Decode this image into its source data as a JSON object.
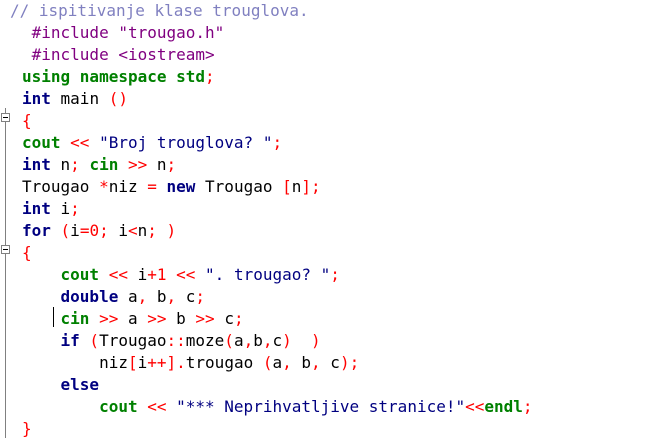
{
  "editor": {
    "lines": [
      [
        {
          "t": "// ispitivanje klase trouglova.",
          "c": "comment"
        }
      ],
      [
        {
          "t": " #include \"trougao.h\"",
          "c": "prep"
        }
      ],
      [
        {
          "t": " #include <iostream>",
          "c": "prep"
        }
      ],
      [
        {
          "t": "using namespace std",
          "c": "lib"
        },
        {
          "t": ";",
          "c": "op"
        }
      ],
      [
        {
          "t": "int",
          "c": "kw"
        },
        {
          "t": " main ",
          "c": "id"
        },
        {
          "t": "()",
          "c": "op"
        }
      ],
      [
        {
          "t": "{",
          "c": "op"
        }
      ],
      [
        {
          "t": "cout",
          "c": "lib"
        },
        {
          "t": " << ",
          "c": "op"
        },
        {
          "t": "\"Broj trouglova? \"",
          "c": "str"
        },
        {
          "t": ";",
          "c": "op"
        }
      ],
      [
        {
          "t": "int",
          "c": "kw"
        },
        {
          "t": " n",
          "c": "id"
        },
        {
          "t": "; ",
          "c": "op"
        },
        {
          "t": "cin",
          "c": "lib"
        },
        {
          "t": " >> ",
          "c": "op"
        },
        {
          "t": "n",
          "c": "id"
        },
        {
          "t": ";",
          "c": "op"
        }
      ],
      [
        {
          "t": "Trougao ",
          "c": "id"
        },
        {
          "t": "*",
          "c": "op"
        },
        {
          "t": "niz ",
          "c": "id"
        },
        {
          "t": "= ",
          "c": "op"
        },
        {
          "t": "new",
          "c": "kw"
        },
        {
          "t": " Trougao ",
          "c": "id"
        },
        {
          "t": "[",
          "c": "op"
        },
        {
          "t": "n",
          "c": "id"
        },
        {
          "t": "];",
          "c": "op"
        }
      ],
      [
        {
          "t": "int",
          "c": "kw"
        },
        {
          "t": " i",
          "c": "id"
        },
        {
          "t": ";",
          "c": "op"
        }
      ],
      [
        {
          "t": "for",
          "c": "kw"
        },
        {
          "t": " (",
          "c": "op"
        },
        {
          "t": "i",
          "c": "id"
        },
        {
          "t": "=",
          "c": "op"
        },
        {
          "t": "0",
          "c": "num"
        },
        {
          "t": "; ",
          "c": "op"
        },
        {
          "t": "i",
          "c": "id"
        },
        {
          "t": "<",
          "c": "op"
        },
        {
          "t": "n",
          "c": "id"
        },
        {
          "t": "; )",
          "c": "op"
        }
      ],
      [
        {
          "t": "{",
          "c": "op"
        }
      ],
      [
        {
          "t": "    cout",
          "c": "lib"
        },
        {
          "t": " << ",
          "c": "op"
        },
        {
          "t": "i",
          "c": "id"
        },
        {
          "t": "+",
          "c": "op"
        },
        {
          "t": "1",
          "c": "num"
        },
        {
          "t": " << ",
          "c": "op"
        },
        {
          "t": "\". trougao? \"",
          "c": "str"
        },
        {
          "t": ";",
          "c": "op"
        }
      ],
      [
        {
          "t": "    double",
          "c": "kw"
        },
        {
          "t": " a",
          "c": "id"
        },
        {
          "t": ", ",
          "c": "op"
        },
        {
          "t": "b",
          "c": "id"
        },
        {
          "t": ", ",
          "c": "op"
        },
        {
          "t": "c",
          "c": "id"
        },
        {
          "t": ";",
          "c": "op"
        }
      ],
      [
        {
          "t": "    cin",
          "c": "lib"
        },
        {
          "t": " >> ",
          "c": "op"
        },
        {
          "t": "a",
          "c": "id"
        },
        {
          "t": " >> ",
          "c": "op"
        },
        {
          "t": "b",
          "c": "id"
        },
        {
          "t": " >> ",
          "c": "op"
        },
        {
          "t": "c",
          "c": "id"
        },
        {
          "t": ";",
          "c": "op"
        }
      ],
      [
        {
          "t": "    if",
          "c": "kw"
        },
        {
          "t": " (",
          "c": "op"
        },
        {
          "t": "Trougao",
          "c": "id"
        },
        {
          "t": "::",
          "c": "op"
        },
        {
          "t": "moze",
          "c": "id"
        },
        {
          "t": "(",
          "c": "op"
        },
        {
          "t": "a",
          "c": "id"
        },
        {
          "t": ",",
          "c": "op"
        },
        {
          "t": "b",
          "c": "id"
        },
        {
          "t": ",",
          "c": "op"
        },
        {
          "t": "c",
          "c": "id"
        },
        {
          "t": ")  )",
          "c": "op"
        }
      ],
      [
        {
          "t": "        niz",
          "c": "id"
        },
        {
          "t": "[",
          "c": "op"
        },
        {
          "t": "i",
          "c": "id"
        },
        {
          "t": "++].",
          "c": "op"
        },
        {
          "t": "trougao ",
          "c": "id"
        },
        {
          "t": "(",
          "c": "op"
        },
        {
          "t": "a",
          "c": "id"
        },
        {
          "t": ", ",
          "c": "op"
        },
        {
          "t": "b",
          "c": "id"
        },
        {
          "t": ", ",
          "c": "op"
        },
        {
          "t": "c",
          "c": "id"
        },
        {
          "t": ");",
          "c": "op"
        }
      ],
      [
        {
          "t": "    else",
          "c": "kw"
        }
      ],
      [
        {
          "t": "        cout",
          "c": "lib"
        },
        {
          "t": " << ",
          "c": "op"
        },
        {
          "t": "\"*** Neprihvatljive stranice!\"",
          "c": "str"
        },
        {
          "t": "<<",
          "c": "op"
        },
        {
          "t": "endl",
          "c": "lib"
        },
        {
          "t": ";",
          "c": "op"
        }
      ],
      [
        {
          "t": "}",
          "c": "op"
        }
      ]
    ],
    "fold_markers": [
      "collapse-fold-icon",
      "collapse-fold-icon"
    ]
  }
}
